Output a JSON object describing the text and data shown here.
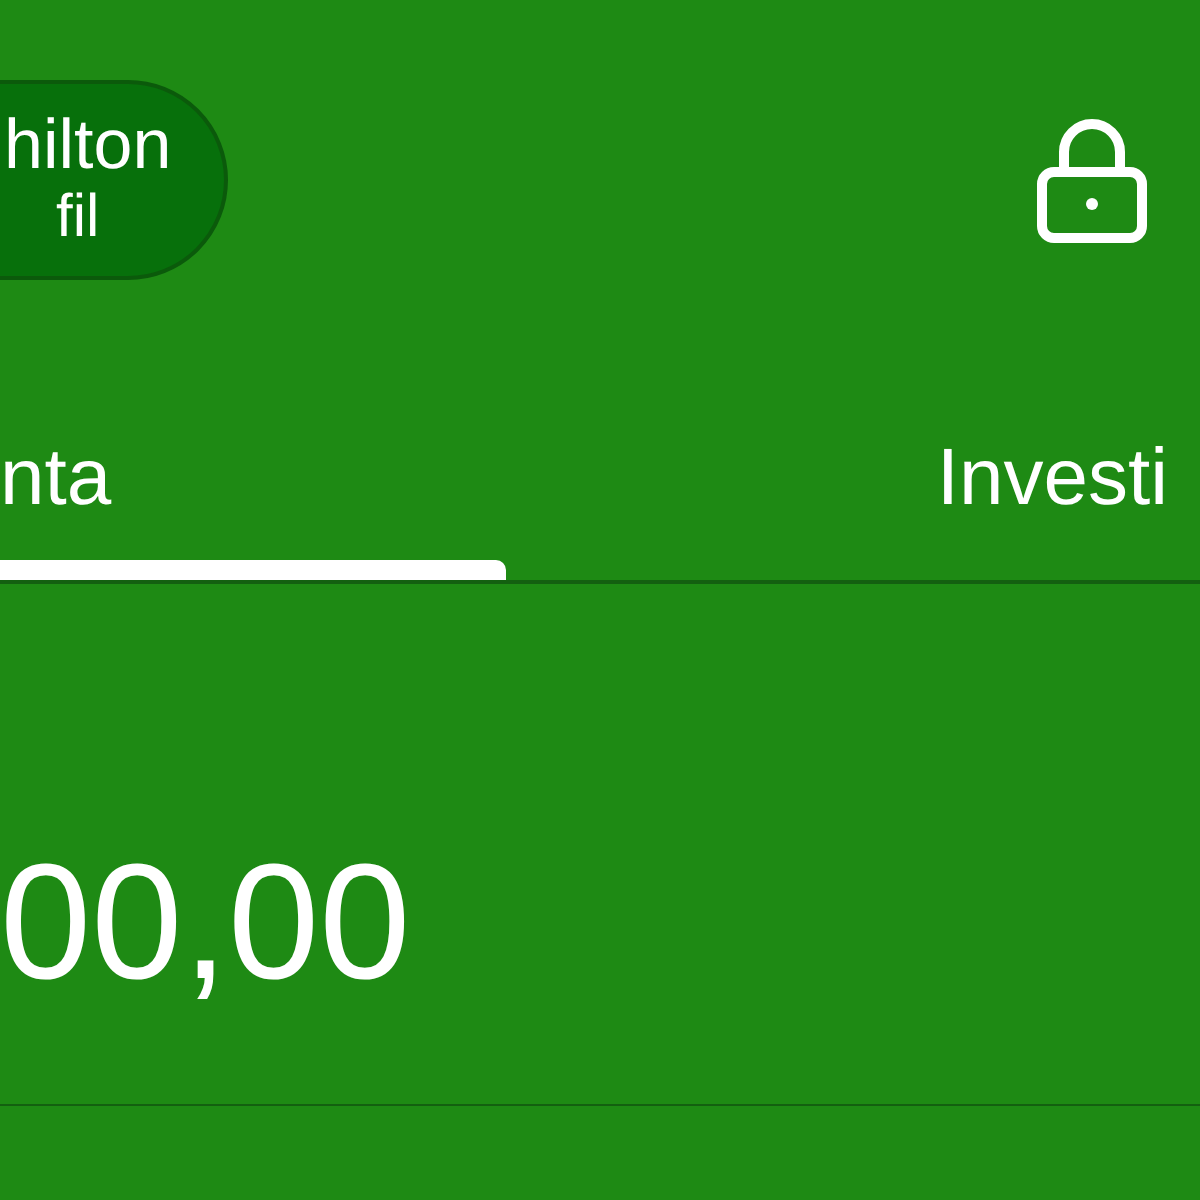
{
  "profile": {
    "name": "hilton",
    "subtitle": "fil"
  },
  "tabs": [
    {
      "label": "nta",
      "selected": true
    },
    {
      "label": "Investi",
      "selected": false
    }
  ],
  "balance": "00,00"
}
